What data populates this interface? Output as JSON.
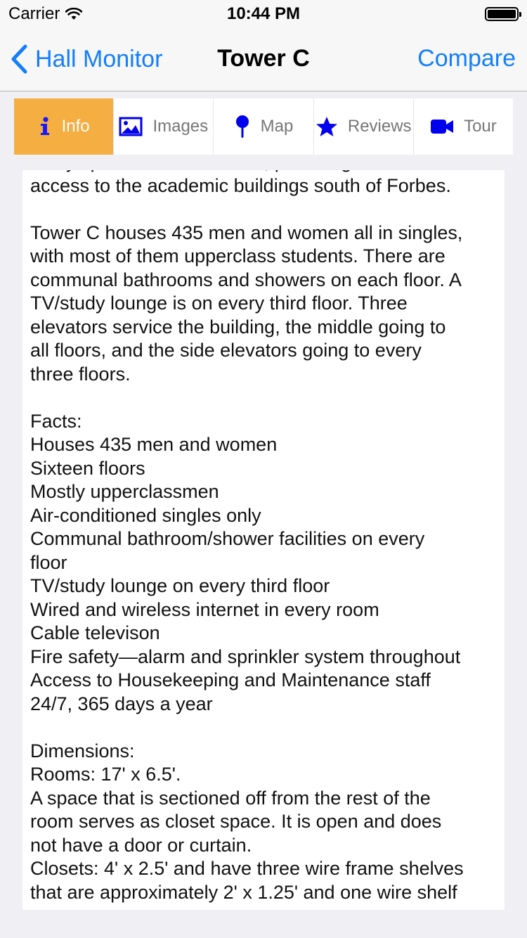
{
  "status_bar": {
    "carrier": "Carrier",
    "time": "10:44 PM"
  },
  "nav": {
    "back_label": "Hall Monitor",
    "title": "Tower C",
    "compare_label": "Compare"
  },
  "tabs": [
    {
      "label": "Info",
      "icon": "info-icon",
      "active": true
    },
    {
      "label": "Images",
      "icon": "image-icon",
      "active": false
    },
    {
      "label": "Map",
      "icon": "map-pin-icon",
      "active": false
    },
    {
      "label": "Reviews",
      "icon": "star-icon",
      "active": false
    },
    {
      "label": "Tour",
      "icon": "video-camera-icon",
      "active": false
    }
  ],
  "colors": {
    "accent_blue": "#147efb",
    "active_tab": "#f4ae42",
    "tab_icon_blue": "#0000ee"
  },
  "content": {
    "text": "lobby spans Forbes Avenue, providing convenient\naccess to the academic buildings south of Forbes.\n\nTower C houses 435 men and women all in singles,\nwith most of them upperclass students. There are\ncommunal bathrooms and showers on each floor. A\nTV/study lounge is on every third floor. Three\nelevators service the building, the middle going to\nall floors, and the side elevators going to every\nthree floors.\n\nFacts:\nHouses 435 men and women\nSixteen floors\nMostly upperclassmen\nAir-conditioned singles only\nCommunal bathroom/shower facilities on every\nfloor\nTV/study lounge on every third floor\nWired and wireless internet in every room\nCable televison\nFire safety—alarm and sprinkler system throughout\nAccess to Housekeeping and Maintenance staff\n24/7, 365 days a year\n\nDimensions:\nRooms: 17' x 6.5'.\nA space that is sectioned off from the rest of the\nroom serves as closet space. It is open and does\nnot have a door or curtain.\nClosets: 4' x 2.5' and have three wire frame shelves\nthat are approximately 2' x 1.25' and one wire shelf"
  }
}
